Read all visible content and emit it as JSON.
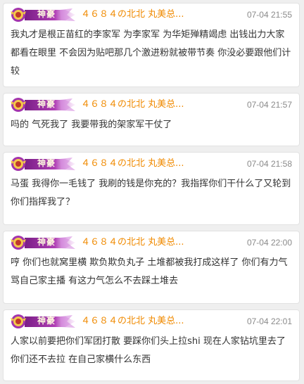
{
  "badge": {
    "label": "神豪"
  },
  "comments": [
    {
      "username": "４６８４の北北 丸美总...",
      "time": "07-04 21:55",
      "text": "我丸才是根正苗红的李家军 为李家军 为华矩殚精竭虑 出钱出力大家都看在眼里 不会因为贴吧那几个激进粉就被带节奏 你没必要跟他们计较"
    },
    {
      "username": "４６８４の北北 丸美总...",
      "time": "07-04 21:57",
      "text": "吗的 气死我了 我要带我的架家军干仗了"
    },
    {
      "username": "４６８４の北北 丸美总...",
      "time": "07-04 21:58",
      "text": "马蛋 我得你一毛钱了 我刷的钱是你充的？我指挥你们干什么了又轮到你们指挥我了？"
    },
    {
      "username": "４６８４の北北 丸美总...",
      "time": "07-04 22:00",
      "text": "哼 你们也就窝里横 欺负欺负丸子 土堆都被我打成这样了 你们有力气骂自己家主播 有这力气怎么不去踩土堆去"
    },
    {
      "username": "４６８４の北北 丸美总...",
      "time": "07-04 22:01",
      "text": "人家以前要把你们军团打散 要踩你们头上拉shi 现在人家钻坑里去了 你们还不去拉 在自己家横什么东西"
    }
  ]
}
